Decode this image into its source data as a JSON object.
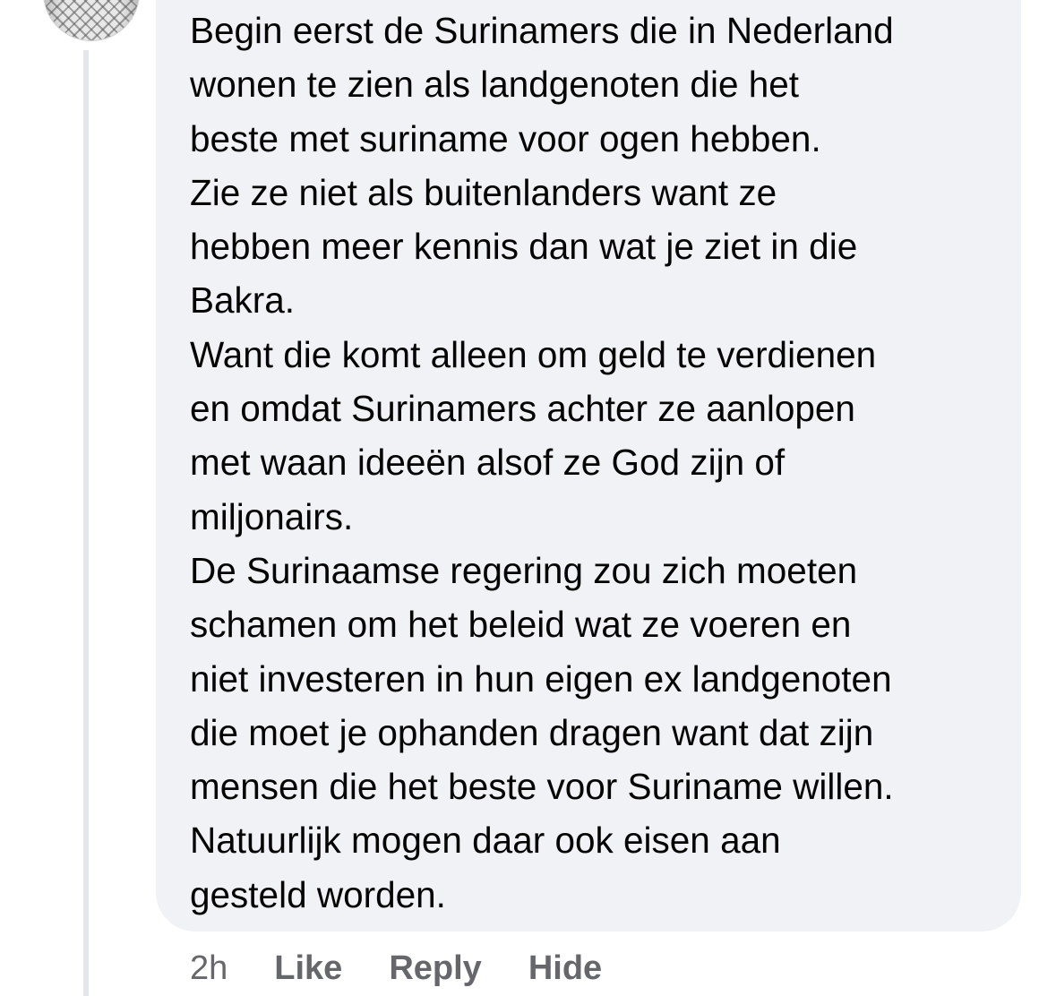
{
  "comment": {
    "lines": [
      "Begin eerst de Surinamers die in Nederland",
      "wonen te zien als landgenoten die het",
      "beste met suriname voor ogen hebben.",
      "Zie ze niet als buitenlanders want ze",
      "hebben meer kennis dan wat je ziet in die",
      "Bakra.",
      "Want die komt alleen om geld te verdienen",
      "en omdat Surinamers achter ze aanlopen",
      "met waan ideeën alsof ze God zijn of",
      "miljonairs.",
      "De Surinaamse regering zou zich moeten",
      "schamen om het beleid wat ze voeren en",
      "niet investeren in hun eigen ex landgenoten",
      "die moet je ophanden dragen want dat zijn",
      "mensen die het beste voor Suriname willen.",
      "Natuurlijk mogen daar ook eisen aan",
      "gesteld worden."
    ]
  },
  "actions": {
    "timestamp": "2h",
    "like_label": "Like",
    "reply_label": "Reply",
    "hide_label": "Hide"
  },
  "colors": {
    "bubble_background": "#f0f2f5",
    "text": "#050505",
    "secondary_text": "#65676b",
    "thread_line": "#e4e6eb"
  }
}
